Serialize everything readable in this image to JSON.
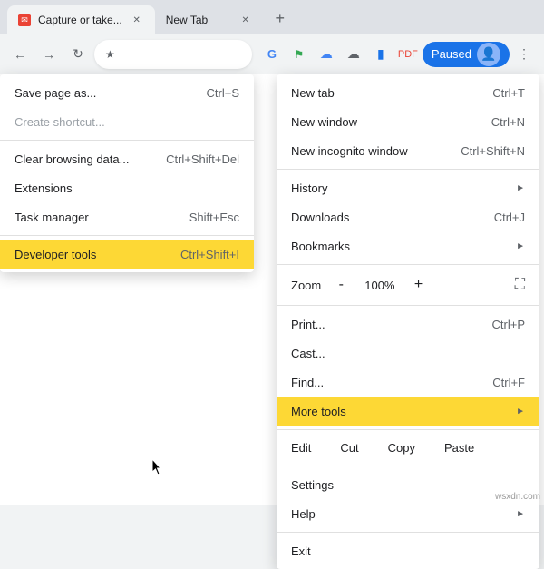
{
  "browser": {
    "tabs": [
      {
        "id": "tab-1",
        "title": "Capture or take...",
        "favicon": "📧",
        "active": false,
        "closeable": true
      },
      {
        "id": "tab-2",
        "title": "New Tab",
        "favicon": "",
        "active": true,
        "closeable": true
      }
    ],
    "new_tab_label": "+",
    "address": "",
    "paused_label": "Paused"
  },
  "left_menu": {
    "items": [
      {
        "id": "save-page",
        "label": "Save page as...",
        "shortcut": "Ctrl+S",
        "disabled": false
      },
      {
        "id": "create-shortcut",
        "label": "Create shortcut...",
        "shortcut": "",
        "disabled": true
      },
      {
        "id": "sep1",
        "type": "separator"
      },
      {
        "id": "clear-browsing",
        "label": "Clear browsing data...",
        "shortcut": "Ctrl+Shift+Del",
        "disabled": false
      },
      {
        "id": "extensions",
        "label": "Extensions",
        "shortcut": "",
        "disabled": false
      },
      {
        "id": "task-manager",
        "label": "Task manager",
        "shortcut": "Shift+Esc",
        "disabled": false
      },
      {
        "id": "sep2",
        "type": "separator"
      },
      {
        "id": "developer-tools",
        "label": "Developer tools",
        "shortcut": "Ctrl+Shift+I",
        "disabled": false,
        "highlighted": true
      }
    ]
  },
  "right_menu": {
    "items": [
      {
        "id": "new-tab",
        "label": "New tab",
        "shortcut": "Ctrl+T",
        "disabled": false
      },
      {
        "id": "new-window",
        "label": "New window",
        "shortcut": "Ctrl+N",
        "disabled": false
      },
      {
        "id": "new-incognito",
        "label": "New incognito window",
        "shortcut": "Ctrl+Shift+N",
        "disabled": false
      },
      {
        "id": "sep1",
        "type": "separator"
      },
      {
        "id": "history",
        "label": "History",
        "shortcut": "",
        "arrow": true,
        "disabled": false
      },
      {
        "id": "downloads",
        "label": "Downloads",
        "shortcut": "Ctrl+J",
        "disabled": false
      },
      {
        "id": "bookmarks",
        "label": "Bookmarks",
        "shortcut": "",
        "arrow": true,
        "disabled": false
      },
      {
        "id": "sep2",
        "type": "separator"
      },
      {
        "id": "zoom",
        "type": "zoom",
        "label": "Zoom",
        "minus": "-",
        "value": "100%",
        "plus": "+",
        "expand": "⤢"
      },
      {
        "id": "sep3",
        "type": "separator"
      },
      {
        "id": "print",
        "label": "Print...",
        "shortcut": "Ctrl+P",
        "disabled": false
      },
      {
        "id": "cast",
        "label": "Cast...",
        "shortcut": "",
        "disabled": false
      },
      {
        "id": "find",
        "label": "Find...",
        "shortcut": "Ctrl+F",
        "disabled": false
      },
      {
        "id": "more-tools",
        "label": "More tools",
        "shortcut": "",
        "arrow": true,
        "disabled": false,
        "highlighted": true
      },
      {
        "id": "sep4",
        "type": "separator"
      },
      {
        "id": "edit",
        "type": "edit",
        "label": "Edit",
        "cut": "Cut",
        "copy": "Copy",
        "paste": "Paste"
      },
      {
        "id": "sep5",
        "type": "separator"
      },
      {
        "id": "settings",
        "label": "Settings",
        "shortcut": "",
        "disabled": false
      },
      {
        "id": "help",
        "label": "Help",
        "shortcut": "",
        "arrow": true,
        "disabled": false
      },
      {
        "id": "sep6",
        "type": "separator"
      },
      {
        "id": "exit",
        "label": "Exit",
        "shortcut": "",
        "disabled": false
      }
    ]
  },
  "watermark": "wsxdn.com"
}
